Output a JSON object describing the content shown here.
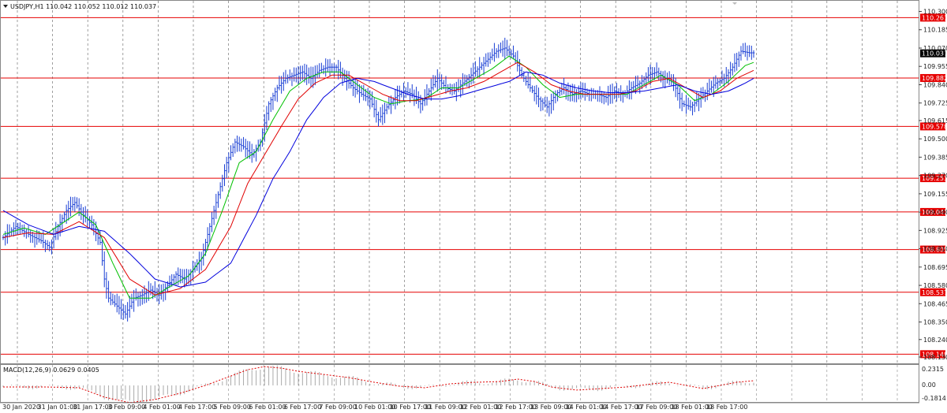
{
  "header": {
    "symbol_text": "USDJPY,H1  110.042 110.052 110.012 110.037"
  },
  "macd": {
    "label": "MACD(12,26,9) 0.0629 0.0405",
    "ticks": [
      "0.2315",
      "0.00",
      "-0.1814"
    ]
  },
  "chart_data": {
    "type": "candlestick",
    "symbol": "USDJPY",
    "timeframe": "H1",
    "ohlc_header": {
      "open": 110.042,
      "high": 110.052,
      "low": 110.012,
      "close": 110.037
    },
    "ylim": [
      108.07,
      110.36
    ],
    "y_ticks": [
      "110.300",
      "110.185",
      "110.070",
      "109.955",
      "109.840",
      "109.725",
      "109.615",
      "109.500",
      "109.385",
      "109.270",
      "109.155",
      "109.040",
      "108.925",
      "108.810",
      "108.695",
      "108.580",
      "108.465",
      "108.350",
      "108.240",
      "108.130"
    ],
    "current_price": "110.037",
    "levels": [
      "110.261",
      "109.882",
      "109.578",
      "109.253",
      "109.041",
      "108.805",
      "108.537",
      "108.148"
    ],
    "x_labels": [
      "30 Jan 2020",
      "31 Jan 01:00",
      "31 Jan 17:00",
      "3 Feb 09:00",
      "4 Feb 01:00",
      "4 Feb 17:00",
      "5 Feb 09:00",
      "6 Feb 01:00",
      "6 Feb 17:00",
      "7 Feb 09:00",
      "10 Feb 01:00",
      "10 Feb 17:00",
      "11 Feb 09:00",
      "12 Feb 01:00",
      "12 Feb 17:00",
      "13 Feb 09:00",
      "14 Feb 01:00",
      "14 Feb 17:00",
      "17 Feb 09:00",
      "18 Feb 01:00",
      "18 Feb 17:00"
    ],
    "price_path": [
      [
        0,
        108.88
      ],
      [
        3,
        108.95
      ],
      [
        6,
        108.9
      ],
      [
        9,
        108.86
      ],
      [
        11,
        108.82
      ],
      [
        13,
        108.95
      ],
      [
        15,
        109.05
      ],
      [
        17,
        109.1
      ],
      [
        19,
        109.02
      ],
      [
        21,
        108.96
      ],
      [
        23,
        108.85
      ],
      [
        24,
        108.62
      ],
      [
        25,
        108.5
      ],
      [
        27,
        108.45
      ],
      [
        29,
        108.4
      ],
      [
        31,
        108.5
      ],
      [
        33,
        108.52
      ],
      [
        35,
        108.55
      ],
      [
        37,
        108.52
      ],
      [
        39,
        108.58
      ],
      [
        41,
        108.65
      ],
      [
        43,
        108.62
      ],
      [
        45,
        108.68
      ],
      [
        47,
        108.75
      ],
      [
        49,
        108.95
      ],
      [
        51,
        109.15
      ],
      [
        53,
        109.35
      ],
      [
        55,
        109.48
      ],
      [
        57,
        109.45
      ],
      [
        59,
        109.4
      ],
      [
        61,
        109.48
      ],
      [
        63,
        109.72
      ],
      [
        65,
        109.82
      ],
      [
        67,
        109.88
      ],
      [
        69,
        109.9
      ],
      [
        71,
        109.92
      ],
      [
        73,
        109.88
      ],
      [
        75,
        109.93
      ],
      [
        77,
        109.95
      ],
      [
        79,
        109.95
      ],
      [
        81,
        109.88
      ],
      [
        83,
        109.82
      ],
      [
        85,
        109.78
      ],
      [
        87,
        109.75
      ],
      [
        89,
        109.62
      ],
      [
        91,
        109.7
      ],
      [
        93,
        109.76
      ],
      [
        95,
        109.8
      ],
      [
        97,
        109.78
      ],
      [
        99,
        109.72
      ],
      [
        101,
        109.8
      ],
      [
        103,
        109.88
      ],
      [
        105,
        109.82
      ],
      [
        107,
        109.8
      ],
      [
        109,
        109.85
      ],
      [
        111,
        109.9
      ],
      [
        113,
        109.95
      ],
      [
        115,
        110.0
      ],
      [
        117,
        110.05
      ],
      [
        119,
        110.07
      ],
      [
        121,
        110.02
      ],
      [
        123,
        109.9
      ],
      [
        125,
        109.82
      ],
      [
        127,
        109.75
      ],
      [
        129,
        109.7
      ],
      [
        131,
        109.78
      ],
      [
        133,
        109.82
      ],
      [
        135,
        109.78
      ],
      [
        137,
        109.8
      ],
      [
        139,
        109.78
      ],
      [
        141,
        109.78
      ],
      [
        143,
        109.76
      ],
      [
        145,
        109.8
      ],
      [
        147,
        109.78
      ],
      [
        149,
        109.82
      ],
      [
        151,
        109.85
      ],
      [
        153,
        109.9
      ],
      [
        155,
        109.92
      ],
      [
        157,
        109.88
      ],
      [
        159,
        109.85
      ],
      [
        161,
        109.72
      ],
      [
        163,
        109.7
      ],
      [
        165,
        109.75
      ],
      [
        167,
        109.8
      ],
      [
        169,
        109.85
      ],
      [
        171,
        109.88
      ],
      [
        173,
        109.95
      ],
      [
        175,
        110.05
      ],
      [
        177,
        110.04
      ]
    ],
    "series": [
      {
        "color": "#00c000",
        "values": [
          [
            0,
            108.9
          ],
          [
            5,
            108.94
          ],
          [
            10,
            108.9
          ],
          [
            14,
            108.97
          ],
          [
            18,
            109.04
          ],
          [
            22,
            108.96
          ],
          [
            26,
            108.72
          ],
          [
            30,
            108.5
          ],
          [
            35,
            108.5
          ],
          [
            40,
            108.58
          ],
          [
            44,
            108.64
          ],
          [
            48,
            108.78
          ],
          [
            52,
            109.05
          ],
          [
            56,
            109.35
          ],
          [
            60,
            109.42
          ],
          [
            64,
            109.62
          ],
          [
            68,
            109.8
          ],
          [
            72,
            109.88
          ],
          [
            76,
            109.92
          ],
          [
            80,
            109.92
          ],
          [
            84,
            109.84
          ],
          [
            88,
            109.76
          ],
          [
            92,
            109.72
          ],
          [
            96,
            109.74
          ],
          [
            100,
            109.75
          ],
          [
            104,
            109.82
          ],
          [
            108,
            109.82
          ],
          [
            112,
            109.88
          ],
          [
            116,
            109.94
          ],
          [
            120,
            110.02
          ],
          [
            124,
            109.95
          ],
          [
            128,
            109.84
          ],
          [
            132,
            109.76
          ],
          [
            136,
            109.78
          ],
          [
            140,
            109.78
          ],
          [
            144,
            109.78
          ],
          [
            148,
            109.78
          ],
          [
            152,
            109.84
          ],
          [
            156,
            109.9
          ],
          [
            160,
            109.84
          ],
          [
            164,
            109.74
          ],
          [
            168,
            109.78
          ],
          [
            172,
            109.86
          ],
          [
            176,
            109.96
          ],
          [
            178,
            109.98
          ]
        ]
      },
      {
        "color": "#e00000",
        "values": [
          [
            0,
            108.88
          ],
          [
            6,
            108.91
          ],
          [
            12,
            108.9
          ],
          [
            18,
            108.98
          ],
          [
            24,
            108.88
          ],
          [
            30,
            108.62
          ],
          [
            36,
            108.52
          ],
          [
            42,
            108.56
          ],
          [
            48,
            108.68
          ],
          [
            54,
            108.95
          ],
          [
            58,
            109.22
          ],
          [
            62,
            109.4
          ],
          [
            66,
            109.58
          ],
          [
            70,
            109.75
          ],
          [
            74,
            109.85
          ],
          [
            78,
            109.9
          ],
          [
            82,
            109.9
          ],
          [
            86,
            109.84
          ],
          [
            90,
            109.78
          ],
          [
            94,
            109.74
          ],
          [
            98,
            109.74
          ],
          [
            102,
            109.77
          ],
          [
            106,
            109.8
          ],
          [
            110,
            109.82
          ],
          [
            114,
            109.86
          ],
          [
            118,
            109.92
          ],
          [
            122,
            109.98
          ],
          [
            126,
            109.92
          ],
          [
            130,
            109.84
          ],
          [
            134,
            109.8
          ],
          [
            138,
            109.78
          ],
          [
            142,
            109.78
          ],
          [
            146,
            109.78
          ],
          [
            150,
            109.8
          ],
          [
            154,
            109.86
          ],
          [
            158,
            109.88
          ],
          [
            162,
            109.82
          ],
          [
            166,
            109.76
          ],
          [
            170,
            109.8
          ],
          [
            174,
            109.88
          ],
          [
            178,
            109.93
          ]
        ]
      },
      {
        "color": "#0000dd",
        "values": [
          [
            0,
            109.05
          ],
          [
            6,
            108.96
          ],
          [
            12,
            108.9
          ],
          [
            18,
            108.95
          ],
          [
            24,
            108.92
          ],
          [
            30,
            108.78
          ],
          [
            36,
            108.62
          ],
          [
            42,
            108.57
          ],
          [
            48,
            108.6
          ],
          [
            54,
            108.72
          ],
          [
            60,
            109.02
          ],
          [
            64,
            109.25
          ],
          [
            68,
            109.42
          ],
          [
            72,
            109.62
          ],
          [
            76,
            109.76
          ],
          [
            80,
            109.85
          ],
          [
            84,
            109.88
          ],
          [
            88,
            109.86
          ],
          [
            92,
            109.82
          ],
          [
            96,
            109.78
          ],
          [
            100,
            109.75
          ],
          [
            104,
            109.75
          ],
          [
            108,
            109.77
          ],
          [
            112,
            109.8
          ],
          [
            116,
            109.83
          ],
          [
            120,
            109.86
          ],
          [
            124,
            109.92
          ],
          [
            128,
            109.9
          ],
          [
            132,
            109.85
          ],
          [
            136,
            109.82
          ],
          [
            140,
            109.8
          ],
          [
            144,
            109.79
          ],
          [
            148,
            109.79
          ],
          [
            152,
            109.8
          ],
          [
            156,
            109.82
          ],
          [
            160,
            109.84
          ],
          [
            164,
            109.8
          ],
          [
            168,
            109.78
          ],
          [
            172,
            109.8
          ],
          [
            176,
            109.85
          ],
          [
            178,
            109.88
          ]
        ]
      }
    ],
    "macd_signal": [
      [
        0,
        -0.02
      ],
      [
        10,
        -0.02
      ],
      [
        18,
        -0.03
      ],
      [
        24,
        -0.15
      ],
      [
        30,
        -0.22
      ],
      [
        36,
        -0.18
      ],
      [
        42,
        -0.1
      ],
      [
        48,
        0.0
      ],
      [
        54,
        0.12
      ],
      [
        58,
        0.2
      ],
      [
        62,
        0.24
      ],
      [
        66,
        0.22
      ],
      [
        70,
        0.18
      ],
      [
        76,
        0.14
      ],
      [
        82,
        0.1
      ],
      [
        88,
        0.04
      ],
      [
        94,
        -0.01
      ],
      [
        100,
        -0.03
      ],
      [
        106,
        0.02
      ],
      [
        112,
        0.04
      ],
      [
        118,
        0.05
      ],
      [
        122,
        0.08
      ],
      [
        126,
        0.05
      ],
      [
        130,
        -0.02
      ],
      [
        136,
        -0.06
      ],
      [
        142,
        -0.04
      ],
      [
        148,
        -0.02
      ],
      [
        154,
        0.02
      ],
      [
        158,
        0.04
      ],
      [
        162,
        0.0
      ],
      [
        166,
        -0.04
      ],
      [
        170,
        0.0
      ],
      [
        174,
        0.04
      ],
      [
        178,
        0.06
      ]
    ]
  }
}
